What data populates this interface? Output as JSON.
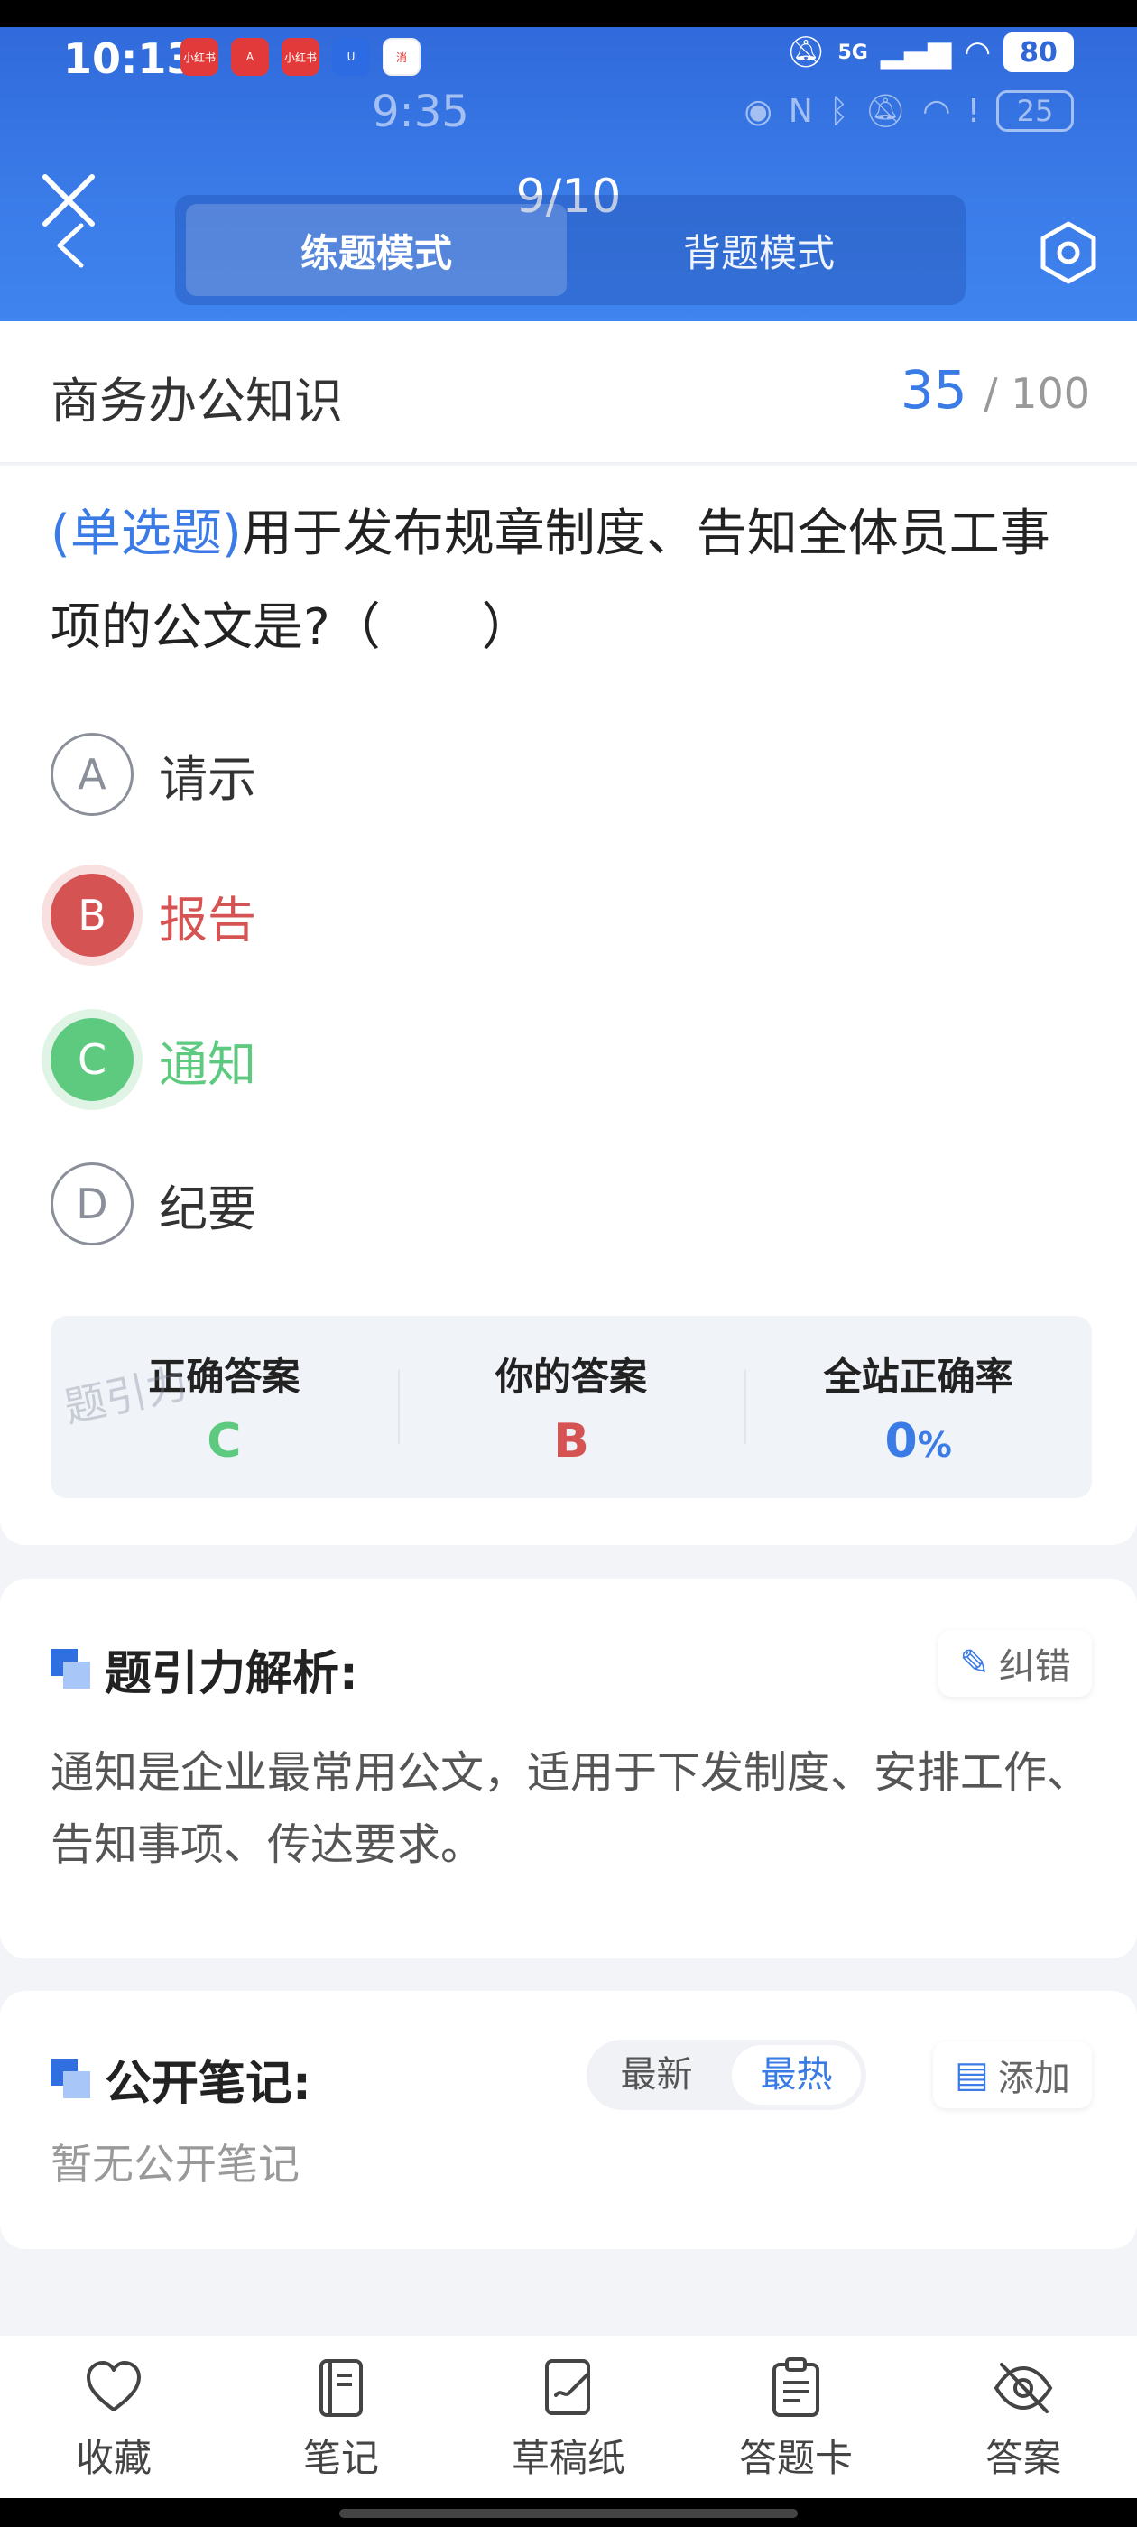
{
  "status_bar": {
    "time": "10:13",
    "signal": "5G",
    "battery": "80",
    "app_icons": [
      "小红书",
      "A",
      "小红书",
      "U",
      "消"
    ]
  },
  "status_bar_2": {
    "time": "9:35",
    "battery": "25"
  },
  "header": {
    "progress": "9/10",
    "mode_practice": "练题模式",
    "mode_review": "背题模式"
  },
  "subject": {
    "title": "商务办公知识",
    "score": "35",
    "total": "/ 100"
  },
  "question": {
    "type": "(单选题)",
    "text": "用于发布规章制度、告知全体员工事项的公文是?（　　）",
    "options": [
      {
        "letter": "A",
        "label": "请示",
        "state": "normal"
      },
      {
        "letter": "B",
        "label": "报告",
        "state": "wrong"
      },
      {
        "letter": "C",
        "label": "通知",
        "state": "correct"
      },
      {
        "letter": "D",
        "label": "纪要",
        "state": "normal"
      }
    ]
  },
  "answer_summary": {
    "correct_label": "正确答案",
    "correct_value": "C",
    "yours_label": "你的答案",
    "yours_value": "B",
    "rate_label": "全站正确率",
    "rate_value": "0",
    "rate_unit": "%",
    "watermark": "题引力"
  },
  "analysis": {
    "title": "题引力解析:",
    "report_label": "纠错",
    "text": "通知是企业最常用公文，适用于下发制度、安排工作、告知事项、传达要求。"
  },
  "notes": {
    "title": "公开笔记:",
    "sort_newest": "最新",
    "sort_hottest": "最热",
    "add_label": "添加",
    "empty_text": "暂无公开笔记"
  },
  "bottom_nav": {
    "items": [
      {
        "label": "收藏",
        "icon": "heart-icon"
      },
      {
        "label": "笔记",
        "icon": "notebook-icon"
      },
      {
        "label": "草稿纸",
        "icon": "draft-icon"
      },
      {
        "label": "答题卡",
        "icon": "clipboard-icon"
      },
      {
        "label": "答案",
        "icon": "eye-off-icon"
      }
    ]
  },
  "colors": {
    "primary": "#3b7be6",
    "correct": "#5dca7f",
    "wrong": "#d65353"
  }
}
